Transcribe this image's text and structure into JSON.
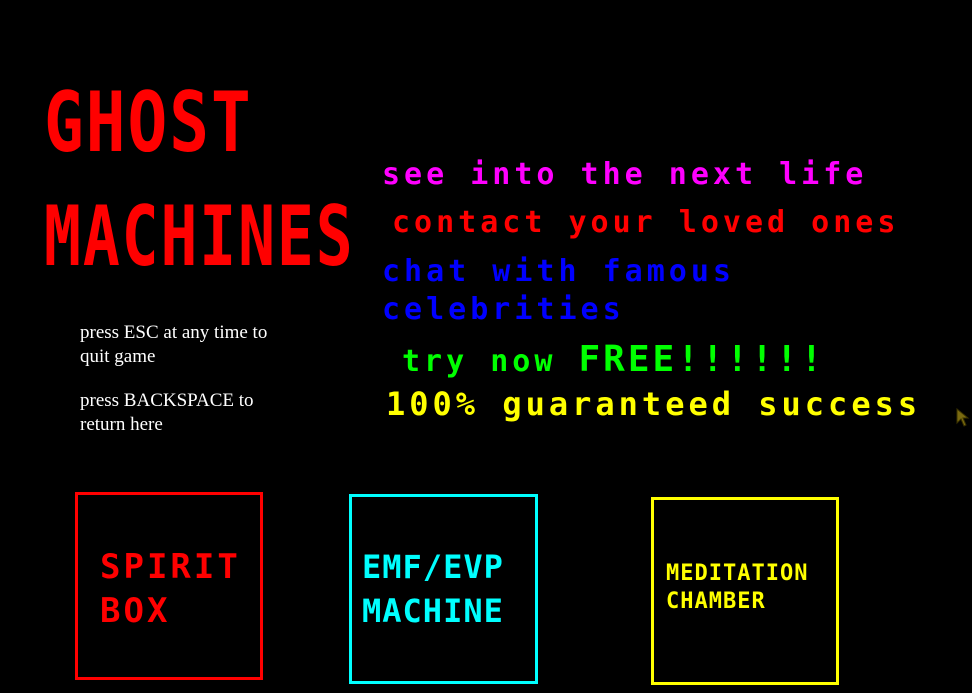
{
  "title": {
    "line1": "GHOST",
    "line2": "MACHINES"
  },
  "taglines": {
    "see": "see into the next life",
    "contact": "contact your loved ones",
    "chat": "chat with famous celebrities",
    "try_prefix": "try now ",
    "try_free": "FREE!!!!!!",
    "guarantee": "100% guaranteed success"
  },
  "help": {
    "quit": "press ESC at any time to quit game",
    "return": "press BACKSPACE to return here"
  },
  "machines": [
    {
      "label": "SPIRIT\nBOX",
      "color": "#ff0000"
    },
    {
      "label": "EMF/EVP\nMACHINE",
      "color": "#00ffff"
    },
    {
      "label": "MEDITATION\nCHAMBER",
      "color": "#ffff00"
    }
  ],
  "colors": {
    "background": "#000000",
    "title": "#ff0000",
    "see": "#ff00ff",
    "contact": "#ff0000",
    "chat": "#0000ff",
    "try": "#00ff00",
    "guarantee": "#ffff00",
    "help_text": "#ffffff"
  },
  "icons": {
    "cursor": "mouse-pointer-icon"
  }
}
